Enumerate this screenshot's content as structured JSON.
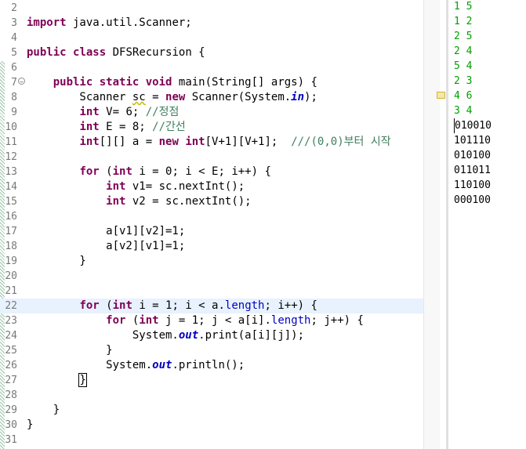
{
  "editor": {
    "lines": [
      {
        "n": "2",
        "segs": []
      },
      {
        "n": "3",
        "segs": [
          {
            "t": "import",
            "c": "kw"
          },
          {
            "t": " java.util.Scanner;"
          }
        ]
      },
      {
        "n": "4",
        "segs": []
      },
      {
        "n": "5",
        "segs": [
          {
            "t": "public",
            "c": "kw"
          },
          {
            "t": " "
          },
          {
            "t": "class",
            "c": "kw"
          },
          {
            "t": " DFSRecursion {"
          }
        ]
      },
      {
        "n": "6",
        "segs": []
      },
      {
        "n": "7",
        "segs": [
          {
            "t": "    "
          },
          {
            "t": "public",
            "c": "kw"
          },
          {
            "t": " "
          },
          {
            "t": "static",
            "c": "kw"
          },
          {
            "t": " "
          },
          {
            "t": "void",
            "c": "kw"
          },
          {
            "t": " main(String[] args) {"
          }
        ],
        "fold": true
      },
      {
        "n": "8",
        "segs": [
          {
            "t": "        Scanner "
          },
          {
            "t": "sc",
            "c": "squig"
          },
          {
            "t": " = "
          },
          {
            "t": "new",
            "c": "kw"
          },
          {
            "t": " Scanner(System."
          },
          {
            "t": "in",
            "c": "fld"
          },
          {
            "t": ");"
          }
        ]
      },
      {
        "n": "9",
        "segs": [
          {
            "t": "        "
          },
          {
            "t": "int",
            "c": "kw"
          },
          {
            "t": " V= 6; "
          },
          {
            "t": "//정점",
            "c": "cm"
          }
        ]
      },
      {
        "n": "10",
        "segs": [
          {
            "t": "        "
          },
          {
            "t": "int",
            "c": "kw"
          },
          {
            "t": " E = 8; "
          },
          {
            "t": "//간선",
            "c": "cm"
          }
        ]
      },
      {
        "n": "11",
        "segs": [
          {
            "t": "        "
          },
          {
            "t": "int",
            "c": "kw"
          },
          {
            "t": "[][] a = "
          },
          {
            "t": "new",
            "c": "kw"
          },
          {
            "t": " "
          },
          {
            "t": "int",
            "c": "kw"
          },
          {
            "t": "[V+1][V+1];  "
          },
          {
            "t": "///(0,0)부터 시작",
            "c": "cm"
          }
        ]
      },
      {
        "n": "12",
        "segs": []
      },
      {
        "n": "13",
        "segs": [
          {
            "t": "        "
          },
          {
            "t": "for",
            "c": "kw"
          },
          {
            "t": " ("
          },
          {
            "t": "int",
            "c": "kw"
          },
          {
            "t": " i = 0; i < E; i++) {"
          }
        ]
      },
      {
        "n": "14",
        "segs": [
          {
            "t": "            "
          },
          {
            "t": "int",
            "c": "kw"
          },
          {
            "t": " v1= sc.nextInt();"
          }
        ]
      },
      {
        "n": "15",
        "segs": [
          {
            "t": "            "
          },
          {
            "t": "int",
            "c": "kw"
          },
          {
            "t": " v2 = sc.nextInt();"
          }
        ]
      },
      {
        "n": "16",
        "segs": []
      },
      {
        "n": "17",
        "segs": [
          {
            "t": "            a[v1][v2]=1;"
          }
        ]
      },
      {
        "n": "18",
        "segs": [
          {
            "t": "            a[v2][v1]=1;"
          }
        ]
      },
      {
        "n": "19",
        "segs": [
          {
            "t": "        }"
          }
        ]
      },
      {
        "n": "20",
        "segs": []
      },
      {
        "n": "21",
        "segs": []
      },
      {
        "n": "22",
        "segs": [
          {
            "t": "        "
          },
          {
            "t": "for",
            "c": "kw"
          },
          {
            "t": " ("
          },
          {
            "t": "int",
            "c": "kw"
          },
          {
            "t": " i = 1; i < a."
          },
          {
            "t": "length",
            "c": "fld2"
          },
          {
            "t": "; i++) {"
          }
        ],
        "current": true
      },
      {
        "n": "23",
        "segs": [
          {
            "t": "            "
          },
          {
            "t": "for",
            "c": "kw"
          },
          {
            "t": " ("
          },
          {
            "t": "int",
            "c": "kw"
          },
          {
            "t": " j = 1; j < a[i]."
          },
          {
            "t": "length",
            "c": "fld2"
          },
          {
            "t": "; j++) {"
          }
        ]
      },
      {
        "n": "24",
        "segs": [
          {
            "t": "                System."
          },
          {
            "t": "out",
            "c": "fld"
          },
          {
            "t": ".print(a[i][j]);"
          }
        ]
      },
      {
        "n": "25",
        "segs": [
          {
            "t": "            }"
          }
        ]
      },
      {
        "n": "26",
        "segs": [
          {
            "t": "            System."
          },
          {
            "t": "out",
            "c": "fld"
          },
          {
            "t": ".println();"
          }
        ]
      },
      {
        "n": "27",
        "segs": [
          {
            "t": "        "
          },
          {
            "t": "}",
            "c": "cursorbox"
          }
        ]
      },
      {
        "n": "28",
        "segs": []
      },
      {
        "n": "29",
        "segs": [
          {
            "t": "    }"
          }
        ]
      },
      {
        "n": "30",
        "segs": [
          {
            "t": "}"
          }
        ]
      },
      {
        "n": "31",
        "segs": []
      }
    ]
  },
  "console": {
    "input_lines": [
      "1 5",
      "1 2",
      "2 5",
      "2 4",
      "5 4",
      "2 3",
      "4 6",
      "3 4"
    ],
    "output_lines": [
      "010010",
      "101110",
      "010100",
      "011011",
      "110100",
      "000100"
    ]
  },
  "colors": {
    "keyword": "#7f0055",
    "comment": "#3f7f5f",
    "field": "#0000c0",
    "console_input": "#00a000",
    "current_line": "#e8f2fe"
  }
}
